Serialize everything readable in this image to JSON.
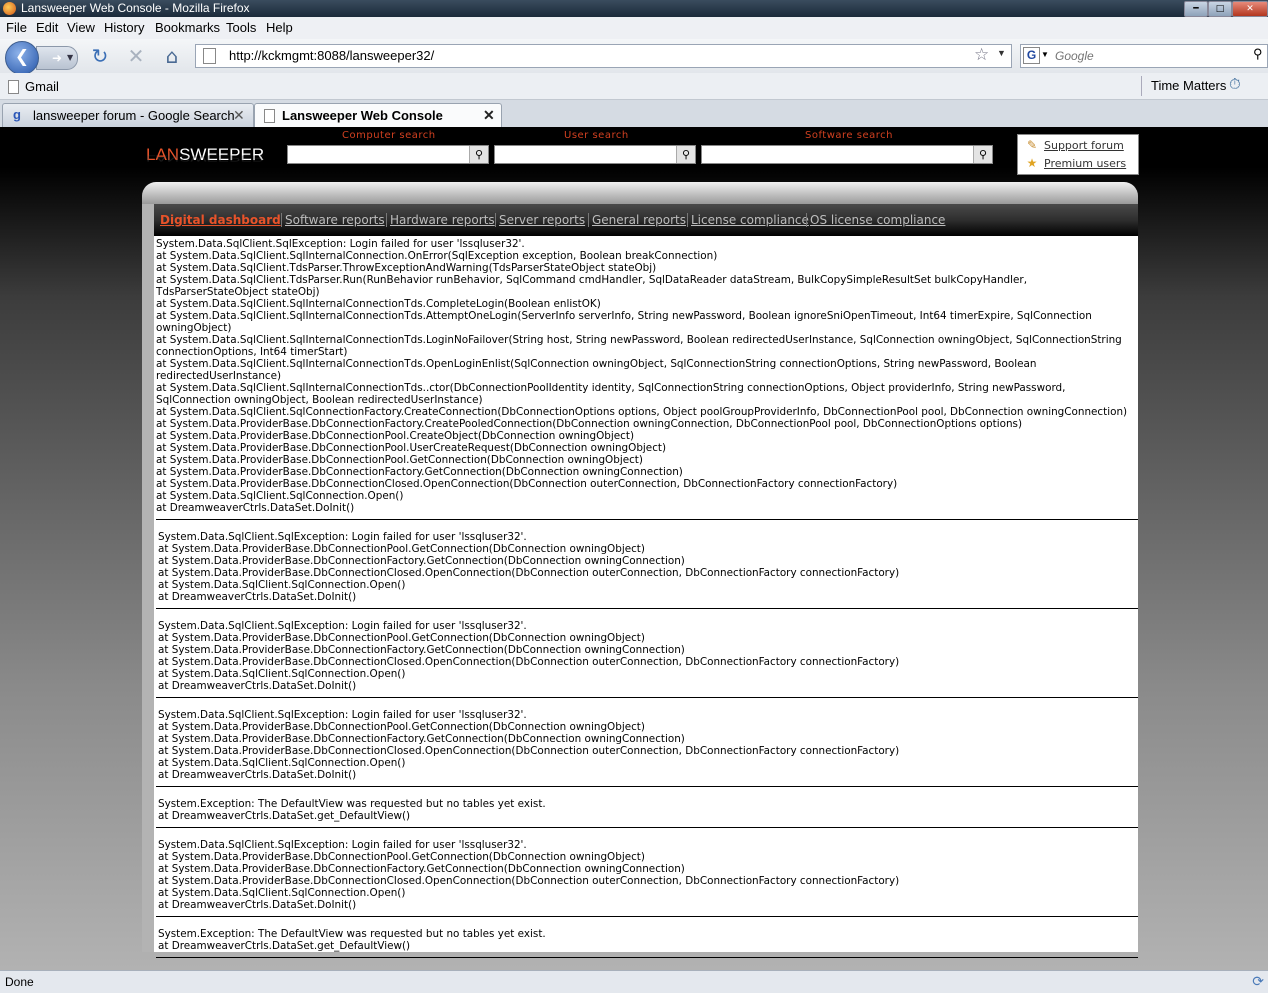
{
  "window": {
    "title": "Lansweeper Web Console - Mozilla Firefox"
  },
  "menu": [
    "File",
    "Edit",
    "View",
    "History",
    "Bookmarks",
    "Tools",
    "Help"
  ],
  "address": {
    "url": "http://kckmgmt:8088/lansweeper32/"
  },
  "search_engine": {
    "placeholder": "Google"
  },
  "bookmarks": {
    "left": "Gmail",
    "right": "Time Matters"
  },
  "tabs": [
    {
      "label": "lansweeper forum - Google Search"
    },
    {
      "label": "Lansweeper Web Console"
    }
  ],
  "page": {
    "logo": {
      "part1": "LAN",
      "part2": "SWEEPER"
    },
    "search_labels": {
      "computer": "Computer search",
      "user": "User search",
      "software": "Software search"
    },
    "links": {
      "support": "Support forum",
      "premium": "Premium users"
    },
    "nav": [
      "Digital dashboard",
      "Software reports",
      "Hardware reports",
      "Server reports",
      "General reports",
      "License compliance",
      "OS license compliance"
    ],
    "errors": [
      {
        "lines": [
          "System.Data.SqlClient.SqlException: Login failed for user 'lssqluser32'.",
          "at System.Data.SqlClient.SqlInternalConnection.OnError(SqlException exception, Boolean breakConnection)",
          "at System.Data.SqlClient.TdsParser.ThrowExceptionAndWarning(TdsParserStateObject stateObj)",
          "at System.Data.SqlClient.TdsParser.Run(RunBehavior runBehavior, SqlCommand cmdHandler, SqlDataReader dataStream, BulkCopySimpleResultSet bulkCopyHandler, TdsParserStateObject stateObj)",
          "at System.Data.SqlClient.SqlInternalConnectionTds.CompleteLogin(Boolean enlistOK)",
          "at System.Data.SqlClient.SqlInternalConnectionTds.AttemptOneLogin(ServerInfo serverInfo, String newPassword, Boolean ignoreSniOpenTimeout, Int64 timerExpire, SqlConnection owningObject)",
          "at System.Data.SqlClient.SqlInternalConnectionTds.LoginNoFailover(String host, String newPassword, Boolean redirectedUserInstance, SqlConnection owningObject, SqlConnectionString connectionOptions, Int64 timerStart)",
          "at System.Data.SqlClient.SqlInternalConnectionTds.OpenLoginEnlist(SqlConnection owningObject, SqlConnectionString connectionOptions, String newPassword, Boolean redirectedUserInstance)",
          "at System.Data.SqlClient.SqlInternalConnectionTds..ctor(DbConnectionPoolIdentity identity, SqlConnectionString connectionOptions, Object providerInfo, String newPassword, SqlConnection owningObject, Boolean redirectedUserInstance)",
          "at System.Data.SqlClient.SqlConnectionFactory.CreateConnection(DbConnectionOptions options, Object poolGroupProviderInfo, DbConnectionPool pool, DbConnection owningConnection)",
          "at System.Data.ProviderBase.DbConnectionFactory.CreatePooledConnection(DbConnection owningConnection, DbConnectionPool pool, DbConnectionOptions options)",
          "at System.Data.ProviderBase.DbConnectionPool.CreateObject(DbConnection owningObject)",
          "at System.Data.ProviderBase.DbConnectionPool.UserCreateRequest(DbConnection owningObject)",
          "at System.Data.ProviderBase.DbConnectionPool.GetConnection(DbConnection owningObject)",
          "at System.Data.ProviderBase.DbConnectionFactory.GetConnection(DbConnection owningConnection)",
          "at System.Data.ProviderBase.DbConnectionClosed.OpenConnection(DbConnection outerConnection, DbConnectionFactory connectionFactory)",
          "at System.Data.SqlClient.SqlConnection.Open()",
          "at DreamweaverCtrls.DataSet.DoInit()"
        ]
      },
      {
        "lines": [
          "System.Data.SqlClient.SqlException: Login failed for user 'lssqluser32'.",
          "at System.Data.ProviderBase.DbConnectionPool.GetConnection(DbConnection owningObject)",
          "at System.Data.ProviderBase.DbConnectionFactory.GetConnection(DbConnection owningConnection)",
          "at System.Data.ProviderBase.DbConnectionClosed.OpenConnection(DbConnection outerConnection, DbConnectionFactory connectionFactory)",
          "at System.Data.SqlClient.SqlConnection.Open()",
          "at DreamweaverCtrls.DataSet.DoInit()"
        ]
      },
      {
        "lines": [
          "System.Data.SqlClient.SqlException: Login failed for user 'lssqluser32'.",
          "at System.Data.ProviderBase.DbConnectionPool.GetConnection(DbConnection owningObject)",
          "at System.Data.ProviderBase.DbConnectionFactory.GetConnection(DbConnection owningConnection)",
          "at System.Data.ProviderBase.DbConnectionClosed.OpenConnection(DbConnection outerConnection, DbConnectionFactory connectionFactory)",
          "at System.Data.SqlClient.SqlConnection.Open()",
          "at DreamweaverCtrls.DataSet.DoInit()"
        ]
      },
      {
        "lines": [
          "System.Data.SqlClient.SqlException: Login failed for user 'lssqluser32'.",
          "at System.Data.ProviderBase.DbConnectionPool.GetConnection(DbConnection owningObject)",
          "at System.Data.ProviderBase.DbConnectionFactory.GetConnection(DbConnection owningConnection)",
          "at System.Data.ProviderBase.DbConnectionClosed.OpenConnection(DbConnection outerConnection, DbConnectionFactory connectionFactory)",
          "at System.Data.SqlClient.SqlConnection.Open()",
          "at DreamweaverCtrls.DataSet.DoInit()"
        ]
      },
      {
        "lines": [
          "System.Exception: The DefaultView was requested but no tables yet exist.",
          "at DreamweaverCtrls.DataSet.get_DefaultView()"
        ]
      },
      {
        "lines": [
          "System.Data.SqlClient.SqlException: Login failed for user 'lssqluser32'.",
          "at System.Data.ProviderBase.DbConnectionPool.GetConnection(DbConnection owningObject)",
          "at System.Data.ProviderBase.DbConnectionFactory.GetConnection(DbConnection owningConnection)",
          "at System.Data.ProviderBase.DbConnectionClosed.OpenConnection(DbConnection outerConnection, DbConnectionFactory connectionFactory)",
          "at System.Data.SqlClient.SqlConnection.Open()",
          "at DreamweaverCtrls.DataSet.DoInit()"
        ]
      },
      {
        "lines": [
          "System.Exception: The DefaultView was requested but no tables yet exist.",
          "at DreamweaverCtrls.DataSet.get_DefaultView()"
        ]
      }
    ]
  },
  "status": {
    "text": "Done"
  },
  "colors": {
    "accent": "#e8532a",
    "titlebar": "#1b2a3a"
  }
}
